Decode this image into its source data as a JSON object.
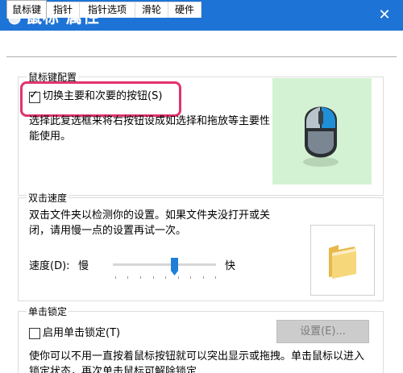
{
  "window": {
    "title": "鼠标 属性",
    "close_glyph": "✕"
  },
  "tabs": [
    {
      "label": "鼠标键",
      "active": true
    },
    {
      "label": "指针"
    },
    {
      "label": "指针选项"
    },
    {
      "label": "滑轮"
    },
    {
      "label": "硬件"
    }
  ],
  "button_config": {
    "group_title": "鼠标键配置",
    "switch_checkbox": {
      "label": "切换主要和次要的按钮(S)",
      "checked": true
    },
    "description": [
      "选择此复选框来将右按钮设成如选择和拖放等主要性",
      "能使用。"
    ]
  },
  "double_click": {
    "group_title": "双击速度",
    "description": [
      "双击文件夹以检测你的设置。如果文件夹没打开或关",
      "闭，请用慢一点的设置再试一次。"
    ],
    "speed_label": "速度(D):",
    "slow_label": "慢",
    "fast_label": "快",
    "speed_level": 0.6
  },
  "click_lock": {
    "group_title": "单击锁定",
    "checkbox": {
      "label": "启用单击锁定(T)",
      "checked": false
    },
    "settings_button": "设置(E)...",
    "description": [
      "使你可以不用一直按着鼠标按钮就可以突出显示或拖拽。单击鼠标以进入",
      "锁定状态，再次单击鼠标可解除锁定"
    ]
  },
  "colors": {
    "title_bar": "#1e73d6",
    "highlight": "#e2336e",
    "preview_bg": "#d3f2d3",
    "mouse_accent": "#1f8fd8"
  },
  "icons": {
    "title": "mouse-icon",
    "preview": "mouse-primary-right-icon",
    "test": "folder-icon"
  }
}
